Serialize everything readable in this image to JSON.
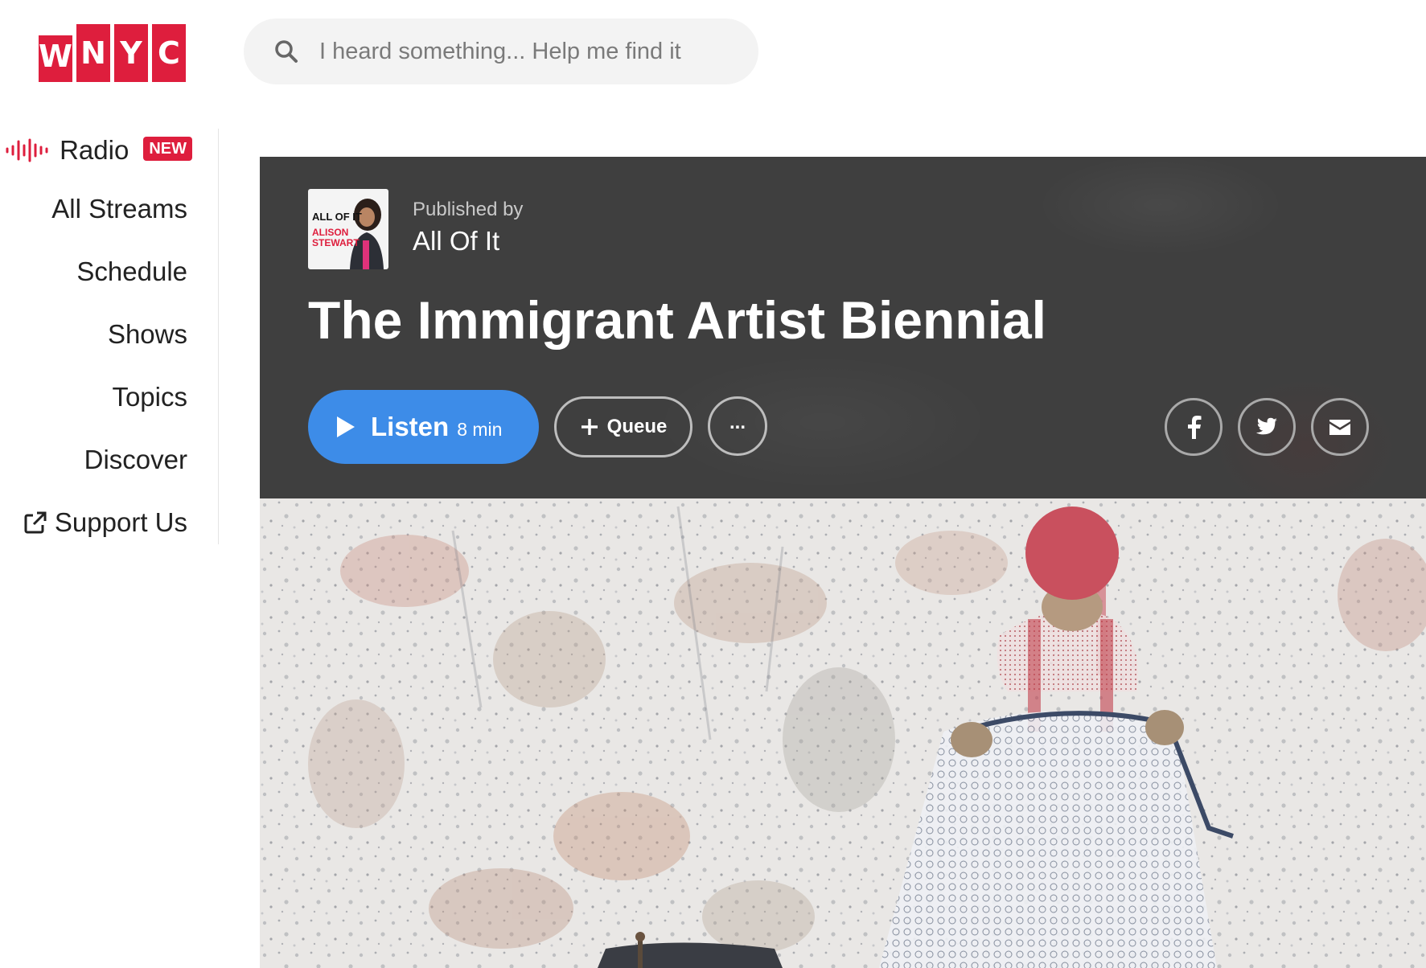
{
  "logo": {
    "letters": [
      "W",
      "N",
      "Y",
      "C"
    ],
    "color": "#de1e3d"
  },
  "search": {
    "placeholder": "I heard something... Help me find it",
    "icon": "search-icon"
  },
  "sidebar": {
    "radio": {
      "label": "Radio",
      "badge": "NEW",
      "icon": "audio-wave-icon"
    },
    "items": [
      {
        "label": "All Streams"
      },
      {
        "label": "Schedule"
      },
      {
        "label": "Shows"
      },
      {
        "label": "Topics"
      },
      {
        "label": "Discover"
      },
      {
        "label": "Support Us",
        "icon": "external-link-icon"
      }
    ]
  },
  "episode": {
    "published_label": "Published by",
    "publisher": "All Of It",
    "show_art_text": [
      "ALL OF IT",
      "ALISON",
      "STEWART"
    ],
    "title": "The Immigrant Artist Biennial",
    "listen_label": "Listen",
    "duration": "8 min",
    "queue_label": "Queue",
    "more_label": "...",
    "share": [
      "facebook-icon",
      "twitter-icon",
      "email-icon"
    ],
    "header_bg": "#3f3f3f",
    "listen_color": "#3d8ce8"
  }
}
